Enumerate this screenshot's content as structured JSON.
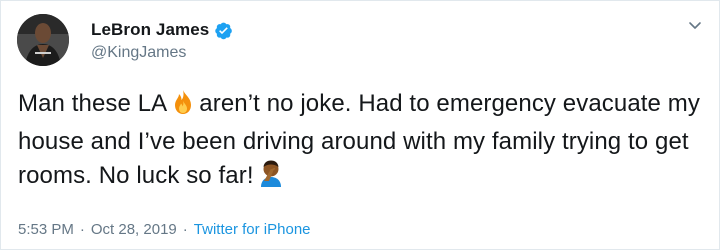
{
  "tweet": {
    "author_name": "LeBron James",
    "handle": "@KingJames",
    "verified": true,
    "text_part1": "Man these LA",
    "text_part2": "aren’t no joke. Had to emergency evacuate my house and I’ve been driving around with my family trying to get rooms. No luck so far!",
    "time": "5:53 PM",
    "date": "Oct 28, 2019",
    "separator": "·",
    "source": "Twitter for iPhone"
  },
  "icons": {
    "verified": "verified-badge-icon",
    "menu": "chevron-down-icon",
    "emoji_fire": "fire-emoji",
    "emoji_facepalm": "facepalm-emoji"
  },
  "colors": {
    "text": "#14171a",
    "secondary": "#657786",
    "link": "#1b95e0",
    "verified": "#1da1f2"
  }
}
